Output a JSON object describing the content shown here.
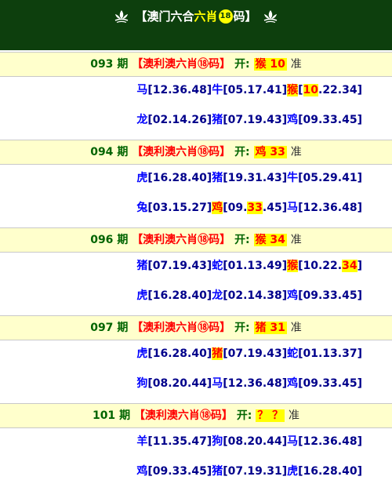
{
  "header": {
    "bracket_open": "【",
    "title_part1": "澳门六合",
    "title_part2": "六肖",
    "badge": "18",
    "title_part3": "码",
    "bracket_close": "】"
  },
  "periods": [
    {
      "num": "093",
      "suffix": "期",
      "name": "【澳利澳六肖⑱码】",
      "kai": "开:",
      "result_animal": "猴",
      "result_num": "10",
      "zhun": "准",
      "line1": [
        {
          "t": "马",
          "z": true
        },
        {
          "t": "[12.36.48]"
        },
        {
          "t": "牛",
          "z": true
        },
        {
          "t": "[05.17.41]"
        },
        {
          "t": "猴",
          "hl": true
        },
        {
          "t": "["
        },
        {
          "t": "10",
          "hl": true
        },
        {
          "t": ".22.34]"
        }
      ],
      "line2": [
        {
          "t": "龙",
          "z": true
        },
        {
          "t": "[02.14.26]"
        },
        {
          "t": "猪",
          "z": true
        },
        {
          "t": "[07.19.43]"
        },
        {
          "t": "鸡",
          "z": true
        },
        {
          "t": "[09.33.45]"
        }
      ]
    },
    {
      "num": "094",
      "suffix": "期",
      "name": "【澳利澳六肖⑱码】",
      "kai": "开:",
      "result_animal": "鸡",
      "result_num": "33",
      "zhun": "准",
      "line1": [
        {
          "t": "虎",
          "z": true
        },
        {
          "t": "[16.28.40]"
        },
        {
          "t": "猪",
          "z": true
        },
        {
          "t": "[19.31.43]"
        },
        {
          "t": "牛",
          "z": true
        },
        {
          "t": "[05.29.41]"
        }
      ],
      "line2": [
        {
          "t": "兔",
          "z": true
        },
        {
          "t": "[03.15.27]"
        },
        {
          "t": "鸡",
          "hl": true
        },
        {
          "t": "[09."
        },
        {
          "t": "33",
          "hl": true
        },
        {
          "t": ".45]"
        },
        {
          "t": "马",
          "z": true
        },
        {
          "t": "[12.36.48]"
        }
      ]
    },
    {
      "num": "096",
      "suffix": "期",
      "name": "【澳利澳六肖⑱码】",
      "kai": "开:",
      "result_animal": "猴",
      "result_num": "34",
      "zhun": "准",
      "line1": [
        {
          "t": "猪",
          "z": true
        },
        {
          "t": "[07.19.43]"
        },
        {
          "t": "蛇",
          "z": true
        },
        {
          "t": "[01.13.49]"
        },
        {
          "t": "猴",
          "hl": true
        },
        {
          "t": "[10.22."
        },
        {
          "t": "34",
          "hl": true
        },
        {
          "t": "]"
        }
      ],
      "line2": [
        {
          "t": "虎",
          "z": true
        },
        {
          "t": "[16.28.40]"
        },
        {
          "t": "龙",
          "z": true
        },
        {
          "t": "[02.14.38]"
        },
        {
          "t": "鸡",
          "z": true
        },
        {
          "t": "[09.33.45]"
        }
      ]
    },
    {
      "num": "097",
      "suffix": "期",
      "name": "【澳利澳六肖⑱码】",
      "kai": "开:",
      "result_animal": "猪",
      "result_num": "31",
      "zhun": "准",
      "line1": [
        {
          "t": "虎",
          "z": true
        },
        {
          "t": "[16.28.40]"
        },
        {
          "t": "猪",
          "hl": true
        },
        {
          "t": "[07.19.43]"
        },
        {
          "t": "蛇",
          "z": true
        },
        {
          "t": "[01.13.37]"
        }
      ],
      "line2": [
        {
          "t": "狗",
          "z": true
        },
        {
          "t": "[08.20.44]"
        },
        {
          "t": "马",
          "z": true
        },
        {
          "t": "[12.36.48]"
        },
        {
          "t": "鸡",
          "z": true
        },
        {
          "t": "[09.33.45]"
        }
      ]
    },
    {
      "num": "101",
      "suffix": "期",
      "name": "【澳利澳六肖⑱码】",
      "kai": "开:",
      "result_animal": "？",
      "result_num": "？",
      "zhun": "准",
      "line1": [
        {
          "t": "羊",
          "z": true
        },
        {
          "t": "[11.35.47]"
        },
        {
          "t": "狗",
          "z": true
        },
        {
          "t": "[08.20.44]"
        },
        {
          "t": "马",
          "z": true
        },
        {
          "t": "[12.36.48]"
        }
      ],
      "line2": [
        {
          "t": "鸡",
          "z": true
        },
        {
          "t": "[09.33.45]"
        },
        {
          "t": "猪",
          "z": true
        },
        {
          "t": "[07.19.31]"
        },
        {
          "t": "虎",
          "z": true
        },
        {
          "t": "[16.28.40]"
        }
      ]
    }
  ]
}
